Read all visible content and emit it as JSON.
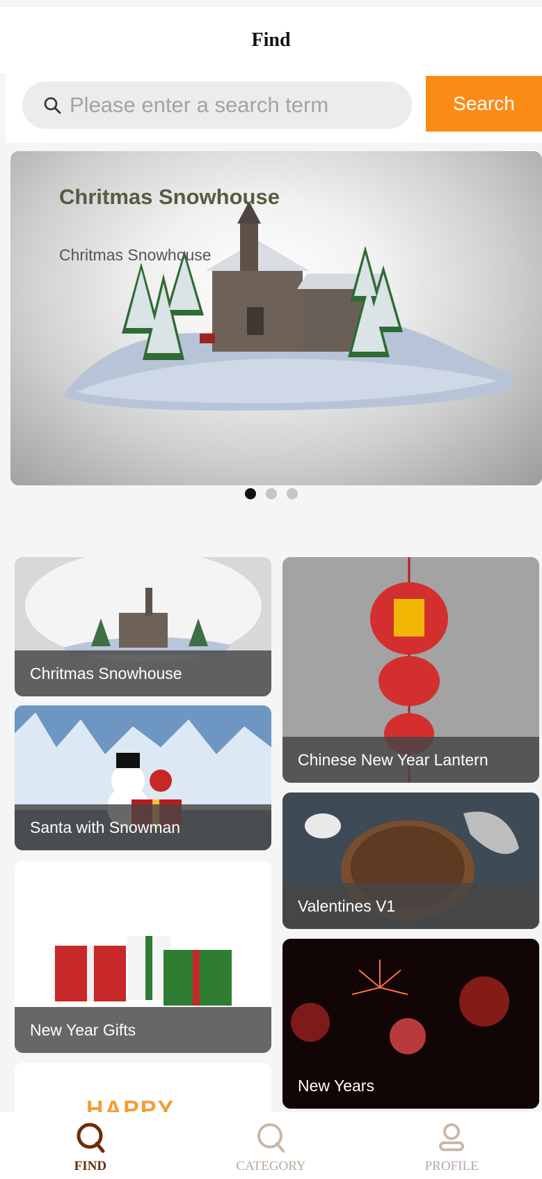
{
  "header": {
    "title": "Find"
  },
  "search": {
    "placeholder": "Please enter a search term",
    "button_label": "Search"
  },
  "banner": {
    "title": "Chritmas Snowhouse",
    "subtitle": "Chritmas Snowhouse",
    "slide_count": 3,
    "active_slide": 1
  },
  "cards": [
    {
      "label": "Chritmas Snowhouse"
    },
    {
      "label": "Chinese New Year Lantern"
    },
    {
      "label": "Santa with Snowman"
    },
    {
      "label": "Valentines V1"
    },
    {
      "label": "New Year Gifts"
    },
    {
      "label": "New Years"
    },
    {
      "label": "HAPPY"
    }
  ],
  "nav": {
    "items": [
      {
        "label": "FIND",
        "icon": "find-icon",
        "active": true
      },
      {
        "label": "CATEGORY",
        "icon": "category-icon",
        "active": false
      },
      {
        "label": "PROFILE",
        "icon": "profile-icon",
        "active": false
      }
    ]
  },
  "colors": {
    "accent": "#fa8c16",
    "nav_active": "#6b2d08",
    "nav_inactive": "#b8a89c"
  }
}
